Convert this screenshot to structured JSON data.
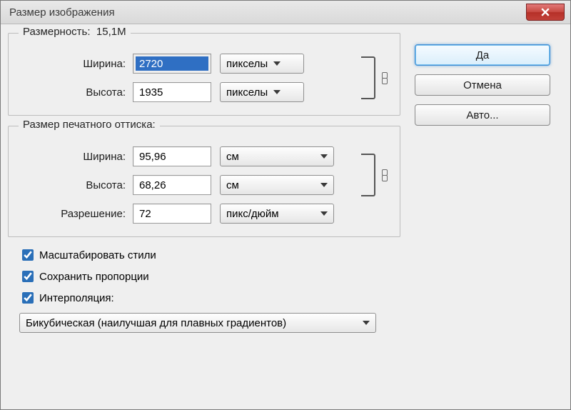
{
  "window": {
    "title": "Размер изображения"
  },
  "buttons": {
    "ok": "Да",
    "cancel": "Отмена",
    "auto": "Авто..."
  },
  "dim": {
    "group": "Размерность:",
    "size": "15,1M",
    "width_lbl": "Ширина:",
    "width_val": "2720",
    "width_unit": "пикселы",
    "height_lbl": "Высота:",
    "height_val": "1935",
    "height_unit": "пикселы"
  },
  "print": {
    "group": "Размер печатного оттиска:",
    "width_lbl": "Ширина:",
    "width_val": "95,96",
    "width_unit": "см",
    "height_lbl": "Высота:",
    "height_val": "68,26",
    "height_unit": "см",
    "res_lbl": "Разрешение:",
    "res_val": "72",
    "res_unit": "пикс/дюйм"
  },
  "checks": {
    "scale_styles": "Масштабировать стили",
    "constrain": "Сохранить пропорции",
    "interp": "Интерполяция:"
  },
  "interp_method": "Бикубическая (наилучшая для плавных градиентов)"
}
